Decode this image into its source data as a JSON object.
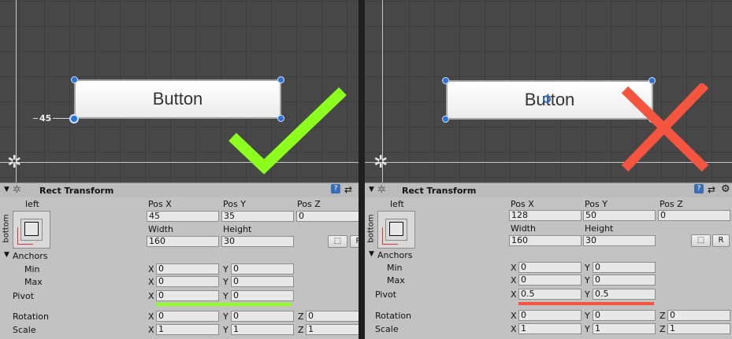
{
  "left": {
    "button_text": "Button",
    "scene_label": "45",
    "rect_transform": {
      "title": "Rect Transform",
      "anchor_h": "left",
      "anchor_v": "bottom",
      "labels": {
        "pos_x": "Pos X",
        "pos_y": "Pos Y",
        "pos_z": "Pos Z",
        "width": "Width",
        "height": "Height"
      },
      "pos_x": "45",
      "pos_y": "35",
      "pos_z": "0",
      "width": "160",
      "height": "30",
      "anchors_label": "Anchors",
      "min_label": "Min",
      "max_label": "Max",
      "min_x": "0",
      "min_y": "0",
      "max_x": "0",
      "max_y": "0",
      "pivot_label": "Pivot",
      "pivot_x": "0",
      "pivot_y": "0",
      "rotation_label": "Rotation",
      "rot_x": "0",
      "rot_y": "0",
      "rot_z": "0",
      "scale_label": "Scale",
      "scale_x": "1",
      "scale_y": "1",
      "scale_z": "1",
      "r_button": "R"
    },
    "verdict": "checkmark",
    "verdict_color": "#8dff1f"
  },
  "right": {
    "button_text": "Button",
    "rect_transform": {
      "title": "Rect Transform",
      "anchor_h": "left",
      "anchor_v": "bottom",
      "labels": {
        "pos_x": "Pos X",
        "pos_y": "Pos Y",
        "pos_z": "Pos Z",
        "width": "Width",
        "height": "Height"
      },
      "pos_x": "128",
      "pos_y": "50",
      "pos_z": "0",
      "width": "160",
      "height": "30",
      "anchors_label": "Anchors",
      "min_label": "Min",
      "max_label": "Max",
      "min_x": "0",
      "min_y": "0",
      "max_x": "0",
      "max_y": "0",
      "pivot_label": "Pivot",
      "pivot_x": "0.5",
      "pivot_y": "0.5",
      "rotation_label": "Rotation",
      "rot_x": "0",
      "rot_y": "0",
      "rot_z": "0",
      "scale_label": "Scale",
      "scale_x": "1",
      "scale_y": "1",
      "scale_z": "1",
      "r_button": "R"
    },
    "verdict": "cross",
    "verdict_color": "#f5553f"
  },
  "axis_letters": {
    "x": "X",
    "y": "Y",
    "z": "Z"
  },
  "icons": [
    "scene-gizmo-icon",
    "rect-transform-icon",
    "help-icon",
    "settings-icon",
    "gear-icon",
    "blueprint-mode-icon",
    "checkmark-icon",
    "cross-icon"
  ]
}
